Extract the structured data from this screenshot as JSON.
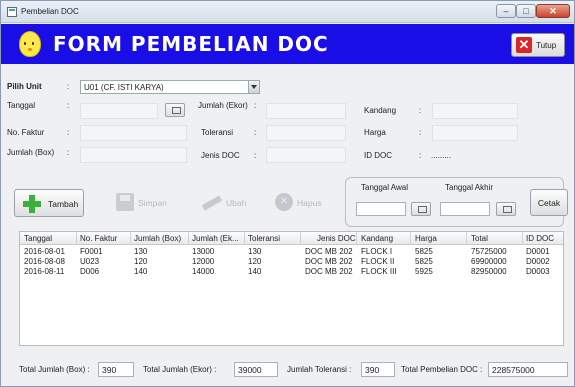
{
  "window": {
    "title": "Pembelian DOC"
  },
  "header": {
    "title": "FORM PEMBELIAN DOC",
    "close_label": "Tutup"
  },
  "form": {
    "unit_label": "Pilih Unit",
    "unit_value": "U01 (CF. ISTI KARYA)",
    "tanggal_label": "Tanggal",
    "jumlah_ekor_label": "Jumlah (Ekor)",
    "kandang_label": "Kandang",
    "no_faktur_label": "No. Faktur",
    "toleransi_label": "Toleransi",
    "harga_label": "Harga",
    "jumlah_box_label": "Jumlah (Box)",
    "jenis_doc_label": "Jenis DOC",
    "id_doc_label": "ID DOC",
    "id_doc_value": ".........",
    "colon": ":"
  },
  "toolbar": {
    "tambah": "Tambah",
    "simpan": "Simpan",
    "ubah": "Ubah",
    "hapus": "Hapus",
    "tanggal_awal": "Tanggal Awal",
    "tanggal_akhir": "Tanggal Akhir",
    "cetak": "Cetak"
  },
  "table": {
    "columns": [
      "Tanggal",
      "No. Faktur",
      "Jumlah (Box)",
      "Jumlah (Ek...",
      "Toleransi",
      "Jenis DOC",
      "Kandang",
      "Harga",
      "Total",
      "ID DOC"
    ],
    "rows": [
      [
        "2016-08-01",
        "F0001",
        "130",
        "13000",
        "130",
        "DOC MB 202",
        "FLOCK I",
        "5825",
        "75725000",
        "D0001"
      ],
      [
        "2016-08-08",
        "U023",
        "120",
        "12000",
        "120",
        "DOC MB 202",
        "FLOCK II",
        "5825",
        "69900000",
        "D0002"
      ],
      [
        "2016-08-11",
        "D006",
        "140",
        "14000",
        "140",
        "DOC MB 202",
        "FLOCK III",
        "5925",
        "82950000",
        "D0003"
      ]
    ]
  },
  "summary": {
    "total_box_label": "Total Jumlah (Box) :",
    "total_box_value": "390",
    "total_ekor_label": "Total Jumlah (Ekor) :",
    "total_ekor_value": "39000",
    "toleransi_label": "Jumlah Toleransi :",
    "toleransi_value": "390",
    "pembelian_label": "Total Pembelian DOC :",
    "pembelian_value": "228575000"
  }
}
